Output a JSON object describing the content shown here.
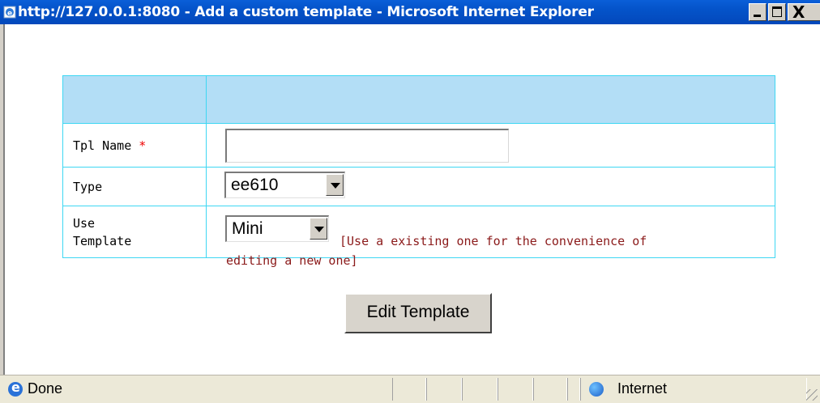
{
  "window": {
    "title": "http://127.0.0.1:8080 - Add a custom template - Microsoft Internet Explorer",
    "close_glyph": "X"
  },
  "form": {
    "tpl_name": {
      "label": "Tpl Name",
      "required_mark": "*",
      "value": ""
    },
    "type": {
      "label": "Type",
      "selected": "ee610"
    },
    "use_template": {
      "label_line1": "Use",
      "label_line2": "Template",
      "selected": "Mini",
      "hint_line1": "[Use a existing one for the convenience of",
      "hint_line2": "editing a new one]"
    },
    "submit_label": "Edit Template"
  },
  "statusbar": {
    "status_text": "Done",
    "zone_text": "Internet"
  },
  "icons": [
    "ie-page-icon",
    "minimize-icon",
    "maximize-icon",
    "close-icon",
    "dropdown-arrow-icon",
    "ie-status-icon",
    "internet-zone-icon",
    "resize-grip-icon"
  ]
}
